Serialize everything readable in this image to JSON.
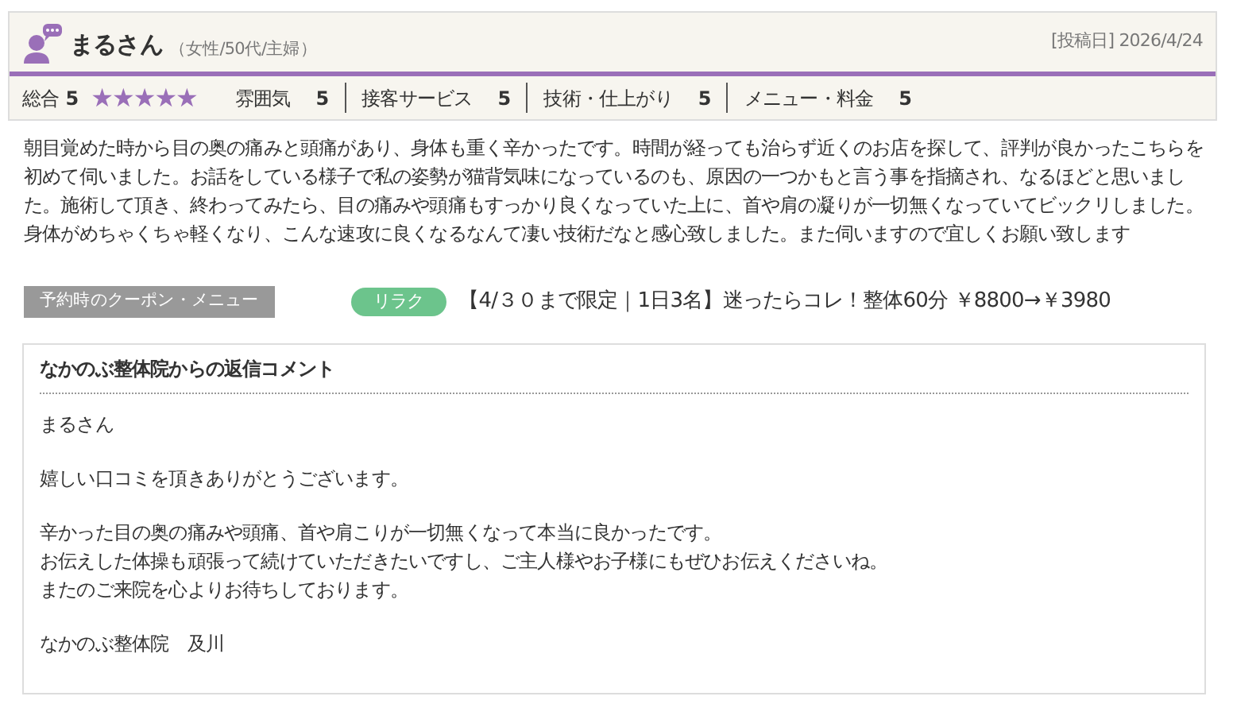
{
  "reviewer": {
    "name": "まるさん",
    "profile": "（女性/50代/主婦）",
    "posted_label": "[投稿日]",
    "posted_date": "2026/4/24"
  },
  "ratings": {
    "overall_label": "総合",
    "overall_value": "5",
    "stars": 5,
    "items": [
      {
        "label": "雰囲気",
        "value": "5"
      },
      {
        "label": "接客サービス",
        "value": "5"
      },
      {
        "label": "技術・仕上がり",
        "value": "5"
      },
      {
        "label": "メニュー・料金",
        "value": "5"
      }
    ]
  },
  "review_text": "朝目覚めた時から目の奥の痛みと頭痛があり、身体も重く辛かったです。時間が経っても治らず近くのお店を探して、評判が良かったこちらを初めて伺いました。お話をしている様子で私の姿勢が猫背気味になっているのも、原因の一つかもと言う事を指摘され、なるほどと思いました。施術して頂き、終わってみたら、目の痛みや頭痛もすっかり良くなっていた上に、首や肩の凝りが一切無くなっていてビックリしました。身体がめちゃくちゃ軽くなり、こんな速攻に良くなるなんて凄い技術だなと感心致しました。また伺いますので宜しくお願い致します",
  "coupon": {
    "label": "予約時のクーポン・メニュー",
    "tag": "リラク",
    "text": "【4/３０まで限定｜1日3名】迷ったらコレ！整体60分 ￥8800→￥3980"
  },
  "reply": {
    "title": "なかのぶ整体院からの返信コメント",
    "paragraphs": [
      [
        "まるさん"
      ],
      [
        "嬉しい口コミを頂きありがとうございます。"
      ],
      [
        "辛かった目の奥の痛みや頭痛、首や肩こりが一切無くなって本当に良かったです。",
        "お伝えした体操も頑張って続けていただきたいですし、ご主人様やお子様にもぜひお伝えくださいね。",
        "またのご来院を心よりお待ちしております。"
      ],
      [
        "なかのぶ整体院　及川"
      ]
    ]
  }
}
